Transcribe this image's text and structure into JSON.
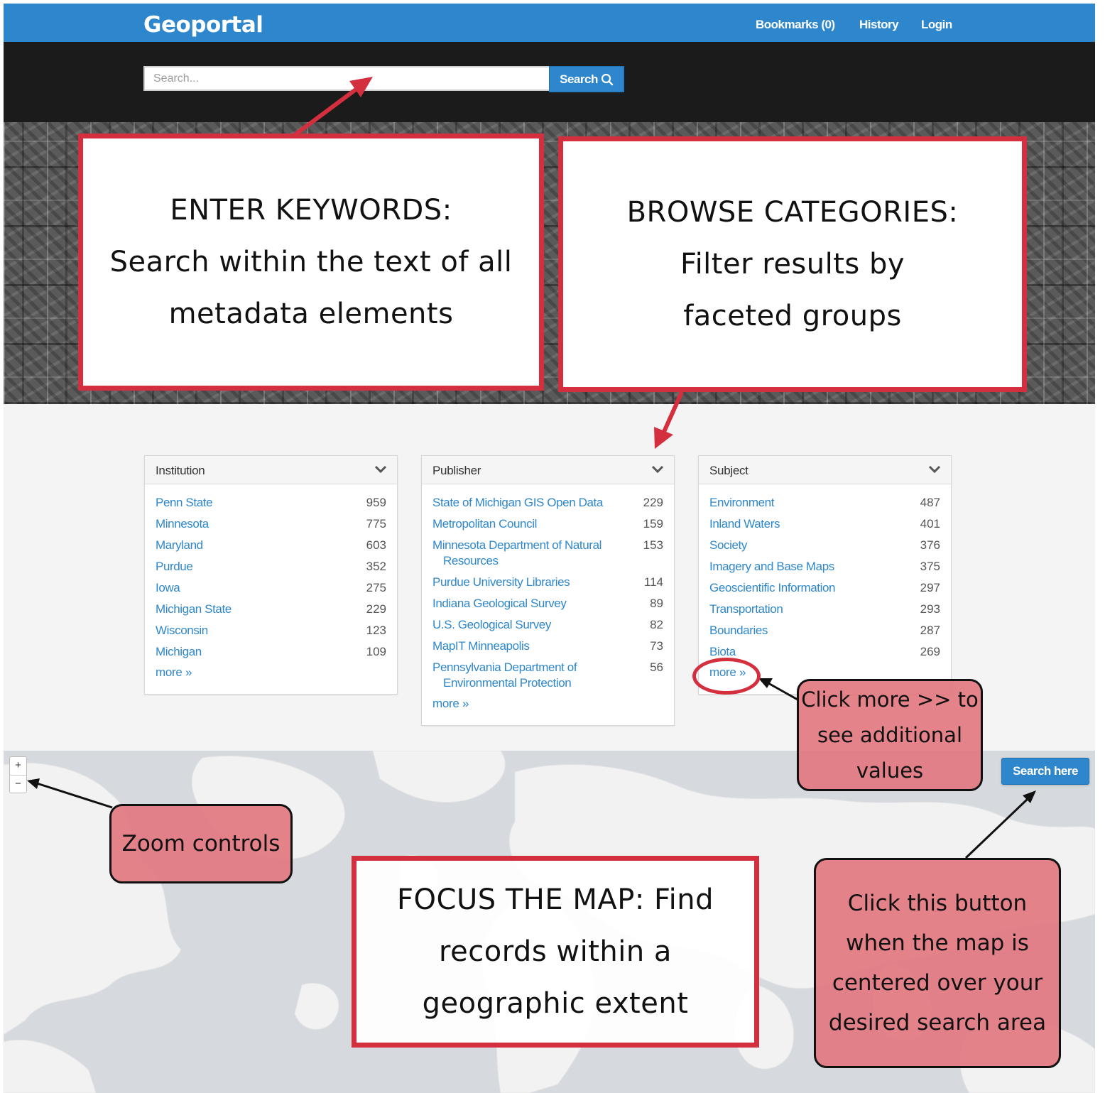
{
  "navbar": {
    "brand": "Geoportal",
    "links": [
      "Bookmarks (0)",
      "History",
      "Login"
    ]
  },
  "search": {
    "placeholder": "Search...",
    "button_label": "Search"
  },
  "facets": [
    {
      "title": "Institution",
      "items": [
        {
          "label": "Penn State",
          "count": "959"
        },
        {
          "label": "Minnesota",
          "count": "775"
        },
        {
          "label": "Maryland",
          "count": "603"
        },
        {
          "label": "Purdue",
          "count": "352"
        },
        {
          "label": "Iowa",
          "count": "275"
        },
        {
          "label": "Michigan State",
          "count": "229"
        },
        {
          "label": "Wisconsin",
          "count": "123"
        },
        {
          "label": "Michigan",
          "count": "109"
        }
      ],
      "more": "more »"
    },
    {
      "title": "Publisher",
      "items": [
        {
          "label": "State of Michigan GIS Open Data",
          "count": "229"
        },
        {
          "label": "Metropolitan Council",
          "count": "159"
        },
        {
          "label": "Minnesota Department of Natural Resources",
          "count": "153"
        },
        {
          "label": "Purdue University Libraries",
          "count": "114"
        },
        {
          "label": "Indiana Geological Survey",
          "count": "89"
        },
        {
          "label": "U.S. Geological Survey",
          "count": "82"
        },
        {
          "label": "MapIT Minneapolis",
          "count": "73"
        },
        {
          "label": "Pennsylvania Department of Environmental Protection",
          "count": "56"
        }
      ],
      "more": "more »"
    },
    {
      "title": "Subject",
      "items": [
        {
          "label": "Environment",
          "count": "487"
        },
        {
          "label": "Inland Waters",
          "count": "401"
        },
        {
          "label": "Society",
          "count": "376"
        },
        {
          "label": "Imagery and Base Maps",
          "count": "375"
        },
        {
          "label": "Geoscientific Information",
          "count": "297"
        },
        {
          "label": "Transportation",
          "count": "293"
        },
        {
          "label": "Boundaries",
          "count": "287"
        },
        {
          "label": "Biota",
          "count": "269"
        }
      ],
      "more": "more »"
    }
  ],
  "map": {
    "zoom_in": "+",
    "zoom_out": "−",
    "search_here": "Search here"
  },
  "annotations": {
    "keywords": [
      "ENTER KEYWORDS:",
      "Search within the text of all",
      "metadata elements"
    ],
    "categories": [
      "BROWSE CATEGORIES:",
      "Filter results by",
      "faceted groups"
    ],
    "more_tip": [
      "Click more >> to",
      "see additional",
      "values"
    ],
    "zoom_tip": "Zoom controls",
    "focus": [
      "FOCUS THE MAP: Find",
      "records within a",
      "geographic extent"
    ],
    "search_here_tip": [
      "Click this button",
      "when the map is",
      "centered over your",
      "desired search area"
    ]
  },
  "colors": {
    "primary": "#2e87cc",
    "annotation_red": "#d42f3f",
    "annotation_pink": "#e27880"
  },
  "icons": [
    "search-icon",
    "chevron-down-icon"
  ]
}
